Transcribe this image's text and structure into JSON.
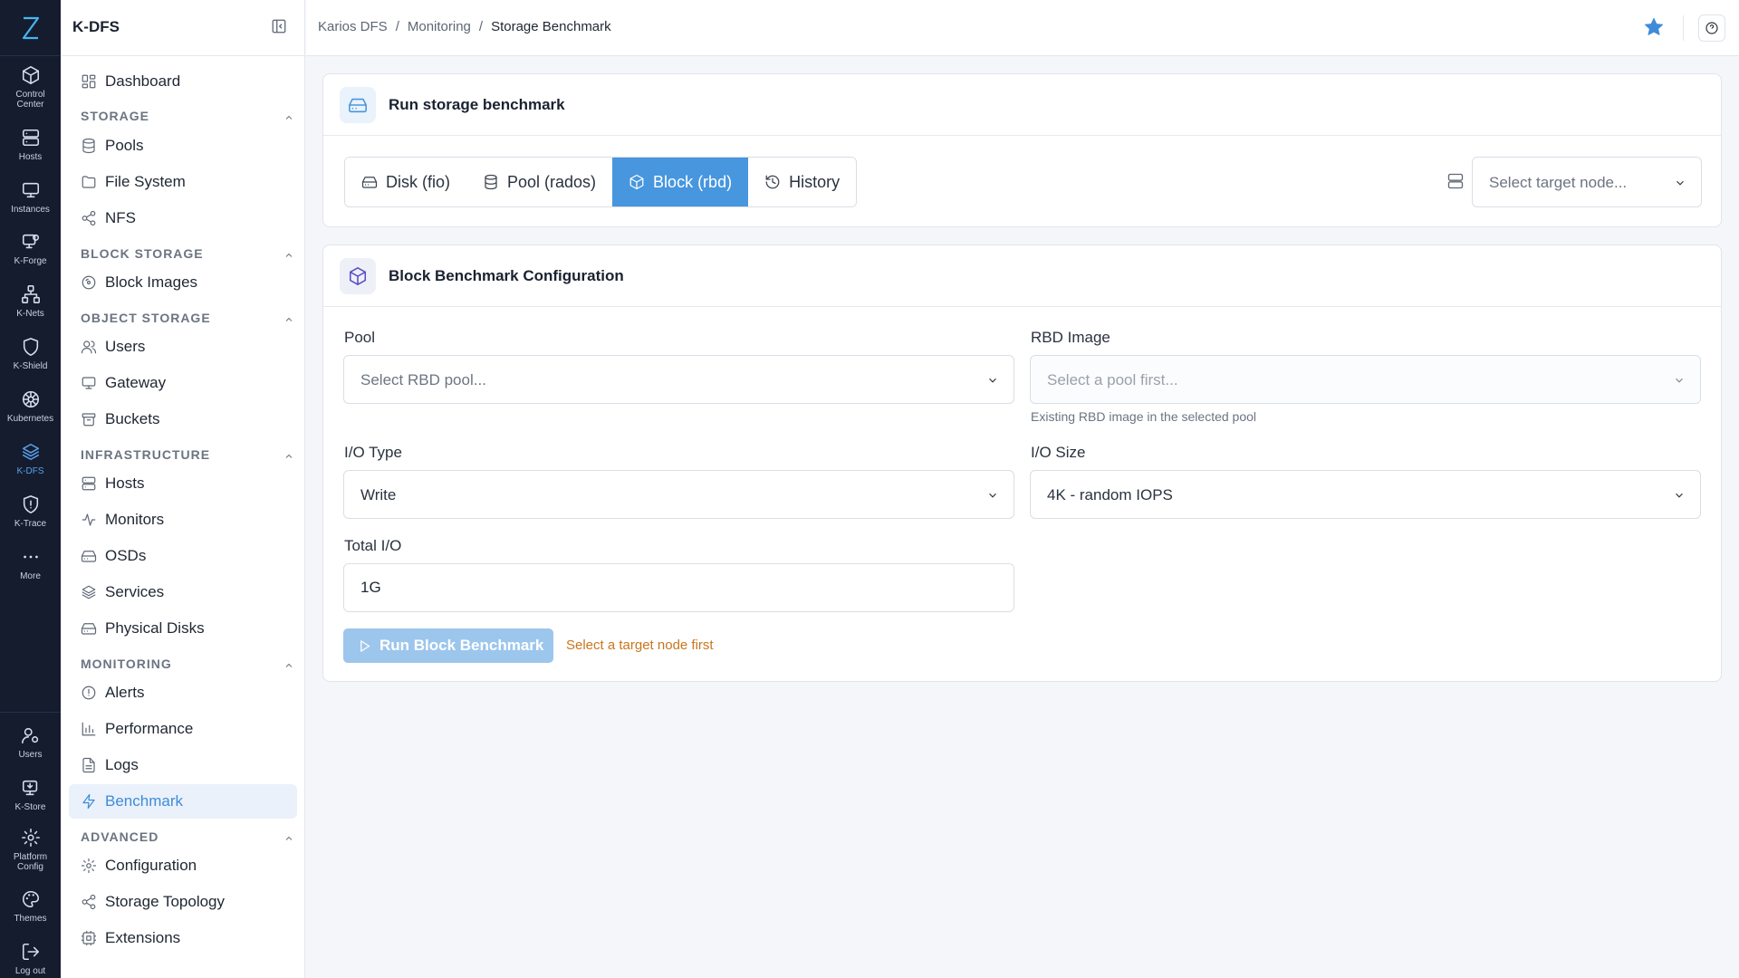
{
  "rail": {
    "items": [
      {
        "label": "Control Center",
        "icon": "cube-icon"
      },
      {
        "label": "Hosts",
        "icon": "server-icon"
      },
      {
        "label": "Instances",
        "icon": "monitor-icon"
      },
      {
        "label": "K-Forge",
        "icon": "forge-icon"
      },
      {
        "label": "K-Nets",
        "icon": "network-icon"
      },
      {
        "label": "K-Shield",
        "icon": "shield-icon"
      },
      {
        "label": "Kubernetes",
        "icon": "helm-icon"
      },
      {
        "label": "K-DFS",
        "icon": "layers-icon"
      },
      {
        "label": "K-Trace",
        "icon": "trace-shield-icon"
      },
      {
        "label": "More",
        "icon": "more-dots-icon"
      }
    ],
    "bottom": [
      {
        "label": "Users",
        "icon": "users-icon"
      },
      {
        "label": "K-Store",
        "icon": "store-icon"
      },
      {
        "label": "Platform Config",
        "icon": "gear-icon"
      },
      {
        "label": "Themes",
        "icon": "palette-icon"
      },
      {
        "label": "Log out",
        "icon": "logout-icon"
      }
    ],
    "active": "K-DFS"
  },
  "sidebar": {
    "title": "K-DFS",
    "dashboard": "Dashboard",
    "sections": {
      "storage": {
        "title": "STORAGE",
        "items": [
          "Pools",
          "File System",
          "NFS"
        ]
      },
      "block": {
        "title": "BLOCK STORAGE",
        "items": [
          "Block Images"
        ]
      },
      "object": {
        "title": "OBJECT STORAGE",
        "items": [
          "Users",
          "Gateway",
          "Buckets"
        ]
      },
      "infra": {
        "title": "INFRASTRUCTURE",
        "items": [
          "Hosts",
          "Monitors",
          "OSDs",
          "Services",
          "Physical Disks"
        ]
      },
      "monitoring": {
        "title": "MONITORING",
        "items": [
          "Alerts",
          "Performance",
          "Logs",
          "Benchmark"
        ]
      },
      "advanced": {
        "title": "ADVANCED",
        "items": [
          "Configuration",
          "Storage Topology",
          "Extensions"
        ]
      }
    },
    "active": "Benchmark"
  },
  "topbar": {
    "breadcrumb": [
      "Karios DFS",
      "Monitoring",
      "Storage Benchmark"
    ],
    "separator": "/"
  },
  "benchmark": {
    "title": "Run storage benchmark",
    "tabs": [
      "Disk (fio)",
      "Pool (rados)",
      "Block (rbd)",
      "History"
    ],
    "active_tab": "Block (rbd)",
    "target_node_placeholder": "Select target node..."
  },
  "config": {
    "title": "Block Benchmark Configuration",
    "pool_label": "Pool",
    "pool_placeholder": "Select RBD pool...",
    "rbd_label": "RBD Image",
    "rbd_placeholder": "Select a pool first...",
    "rbd_hint": "Existing RBD image in the selected pool",
    "io_type_label": "I/O Type",
    "io_type_value": "Write",
    "io_size_label": "I/O Size",
    "io_size_value": "4K - random IOPS",
    "total_io_label": "Total I/O",
    "total_io_value": "1G",
    "run_label": "Run Block Benchmark",
    "warning": "Select a target node first"
  },
  "colors": {
    "accent": "#4796de",
    "rail_bg": "#141c2e",
    "warning": "#c9761d",
    "star": "#3f8bd8"
  }
}
